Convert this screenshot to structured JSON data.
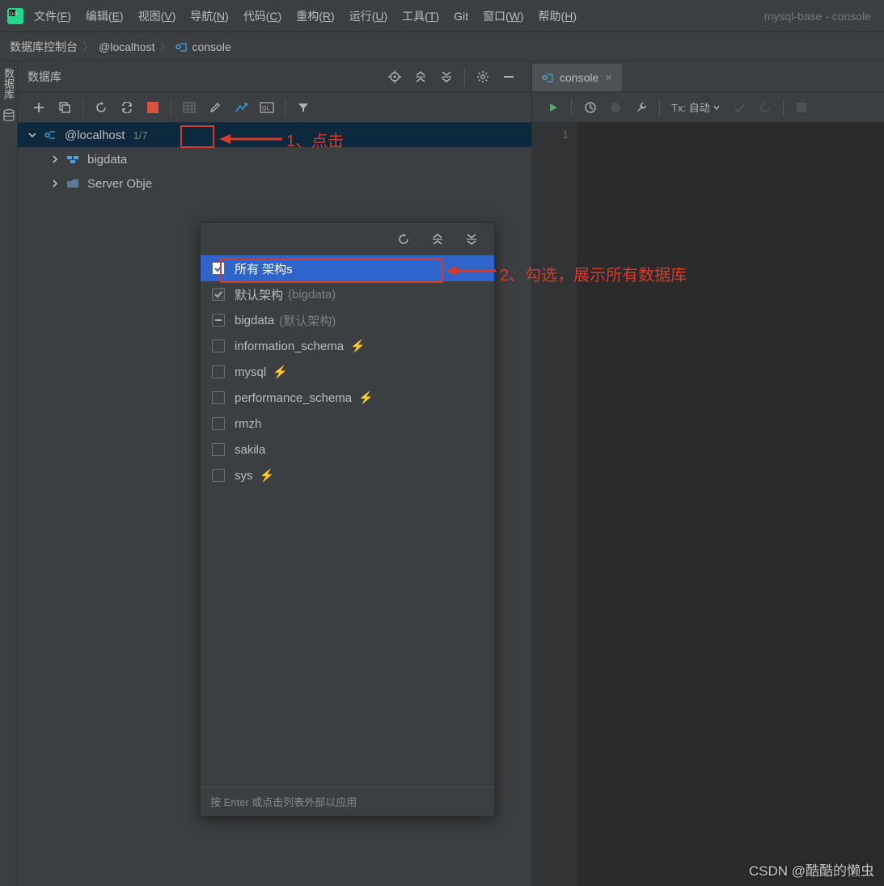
{
  "window": {
    "title": "mysql-base - console"
  },
  "menu": {
    "file": {
      "label": "文件",
      "accel": "F"
    },
    "edit": {
      "label": "编辑",
      "accel": "E"
    },
    "view": {
      "label": "视图",
      "accel": "V"
    },
    "navigate": {
      "label": "导航",
      "accel": "N"
    },
    "code": {
      "label": "代码",
      "accel": "C"
    },
    "refactor": {
      "label": "重构",
      "accel": "R"
    },
    "run": {
      "label": "运行",
      "accel": "U"
    },
    "tools": {
      "label": "工具",
      "accel": "T"
    },
    "git": {
      "label": "Git",
      "accel": ""
    },
    "window": {
      "label": "窗口",
      "accel": "W"
    },
    "help": {
      "label": "帮助",
      "accel": "H"
    }
  },
  "breadcrumbs": {
    "root": "数据库控制台",
    "host": "@localhost",
    "console": "console"
  },
  "gutter": {
    "label": "数据库"
  },
  "panel": {
    "title": "数据库"
  },
  "tree": {
    "root": {
      "label": "@localhost",
      "badge": "1/7"
    },
    "children": [
      {
        "label": "bigdata"
      },
      {
        "label": "Server Obje"
      }
    ]
  },
  "popup": {
    "items": [
      {
        "label": "所有 架构s",
        "checked": true,
        "selected": true
      },
      {
        "label": "默认架构",
        "note": "(bigdata)",
        "checked": true
      },
      {
        "label": "bigdata",
        "note": "(默认架构)",
        "partial": true
      },
      {
        "label": "information_schema",
        "bolt": true
      },
      {
        "label": "mysql",
        "bolt": true
      },
      {
        "label": "performance_schema",
        "bolt": true
      },
      {
        "label": "rmzh"
      },
      {
        "label": "sakila"
      },
      {
        "label": "sys",
        "bolt": true
      }
    ],
    "footer": "按 Enter 或点击列表外部以应用"
  },
  "editor": {
    "tab": "console",
    "tx": "Tx: 自动",
    "line": "1"
  },
  "annotations": {
    "step1": "1、点击",
    "step2": "2、勾选，展示所有数据库"
  },
  "watermark": "CSDN @酷酷的懒虫"
}
